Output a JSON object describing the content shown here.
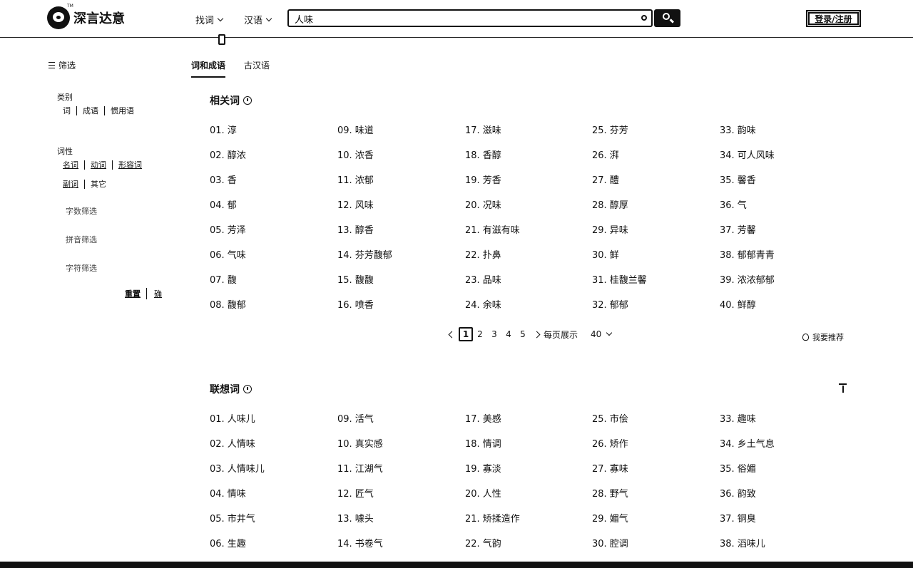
{
  "header": {
    "logo_text": "深言达意",
    "logo_tm": "TM",
    "nav": [
      {
        "label": "找词"
      },
      {
        "label": "汉语"
      }
    ],
    "search": {
      "value": "人味",
      "placeholder": ""
    },
    "login_label": "登录/注册"
  },
  "sidebar": {
    "filter_title": "筛选",
    "category": {
      "label": "类别",
      "options": [
        "词",
        "成语",
        "惯用语"
      ]
    },
    "pos": {
      "label": "词性",
      "row1": [
        "名词",
        "动词",
        "形容词"
      ],
      "row2": [
        "副词",
        "其它"
      ]
    },
    "filters": [
      "字数筛选",
      "拼音筛选",
      "字符筛选"
    ],
    "reset_label": "重置",
    "confirm_label": "确"
  },
  "tabs": [
    {
      "label": "词和成语",
      "active": true
    },
    {
      "label": "古汉语",
      "active": false
    }
  ],
  "related": {
    "title": "相关词",
    "columns": [
      [
        "01. 淳",
        "02. 醇浓",
        "03. 香",
        "04. 郁",
        "05. 芳泽",
        "06. 气味",
        "07. 馥",
        "08. 馥郁"
      ],
      [
        "09. 味道",
        "10. 浓香",
        "11. 浓郁",
        "12. 风味",
        "13. 醇香",
        "14. 芬芳馥郁",
        "15. 馥馥",
        "16. 喷香"
      ],
      [
        "17. 滋味",
        "18. 香醇",
        "19. 芳香",
        "20. 况味",
        "21. 有滋有味",
        "22. 扑鼻",
        "23. 品味",
        "24. 余味"
      ],
      [
        "25. 芬芳",
        "26. 湃",
        "27. 醴",
        "28. 醇厚",
        "29. 异味",
        "30. 鲜",
        "31. 桂馥兰馨",
        "32. 郁郁"
      ],
      [
        "33. 韵味",
        "34. 可人风味",
        "35. 馨香",
        "36. 气",
        "37. 芳馨",
        "38. 郁郁青青",
        "39. 浓浓郁郁",
        "40. 鲜醇"
      ]
    ],
    "pagination": {
      "pages": [
        "1",
        "2",
        "3",
        "4",
        "5"
      ],
      "current": "1",
      "per_page_label": "每页展示",
      "per_page_value": "40"
    },
    "recommend_label": "我要推荐"
  },
  "associated": {
    "title": "联想词",
    "columns": [
      [
        "01. 人味儿",
        "02. 人情味",
        "03. 人情味儿",
        "04. 情味",
        "05. 市井气",
        "06. 生趣"
      ],
      [
        "09. 活气",
        "10. 真实感",
        "11. 江湖气",
        "12. 匠气",
        "13. 噱头",
        "14. 书卷气"
      ],
      [
        "17. 美感",
        "18. 情调",
        "19. 寡淡",
        "20. 人性",
        "21. 矫揉造作",
        "22. 气韵"
      ],
      [
        "25. 市侩",
        "26. 矫作",
        "27. 寡味",
        "28. 野气",
        "29. 媚气",
        "30. 腔调"
      ],
      [
        "33. 趣味",
        "34. 乡土气息",
        "35. 俗媚",
        "36. 韵致",
        "37. 铜臭",
        "38. 滔味儿"
      ]
    ]
  }
}
